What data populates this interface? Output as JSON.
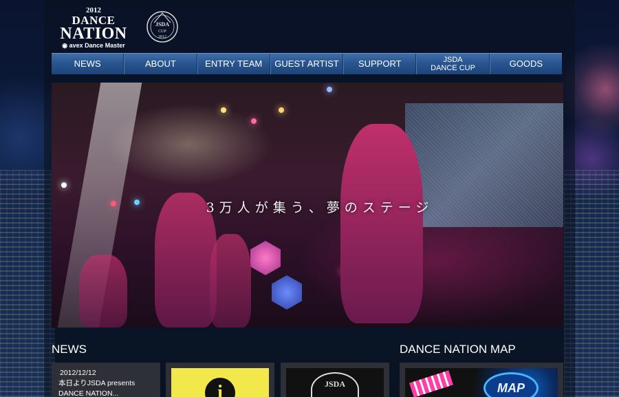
{
  "header": {
    "logo": {
      "year": "2012",
      "line1": "DANCE",
      "line2": "NATION",
      "tagline": "avex Dance Master"
    },
    "emblem": "JSDA DANCE CUP 2012 emblem"
  },
  "nav": {
    "items": [
      {
        "label": "NEWS"
      },
      {
        "label": "ABOUT"
      },
      {
        "label": "ENTRY TEAM"
      },
      {
        "label": "GUEST ARTIST"
      },
      {
        "label": "SUPPORT"
      },
      {
        "label_line1": "JSDA",
        "label_line2": "DANCE CUP"
      },
      {
        "label": "GOODS"
      }
    ],
    "colors": {
      "bar": "#2a5590",
      "border": "#16345c"
    }
  },
  "hero": {
    "caption": "3万人が集う、夢のステージ"
  },
  "news": {
    "title": "NEWS",
    "items": [
      {
        "date": "2012/12/12",
        "text": "本日よりJSDA presents DANCE NATION..."
      }
    ],
    "thumb_info_glyph": "i",
    "thumb_jsda_label": "JSDA"
  },
  "map": {
    "title": "DANCE NATION MAP",
    "badge": "MAP"
  },
  "colors": {
    "background": "#050b1a",
    "info_yellow": "#f2e84c",
    "card_gray": "#2e3038",
    "map_blue": "#48b4ff"
  }
}
